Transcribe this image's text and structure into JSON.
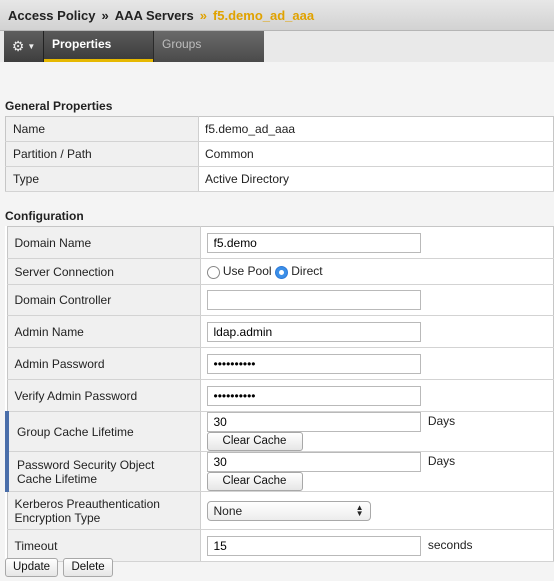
{
  "breadcrumb": {
    "items": [
      "Access Policy",
      "AAA Servers"
    ],
    "separator": "»",
    "current": "f5.demo_ad_aaa"
  },
  "tabs": {
    "gear_icon": "gear-icon",
    "properties": "Properties",
    "groups": "Groups"
  },
  "general": {
    "title": "General Properties",
    "rows": [
      {
        "label": "Name",
        "value": "f5.demo_ad_aaa"
      },
      {
        "label": "Partition / Path",
        "value": "Common"
      },
      {
        "label": "Type",
        "value": "Active Directory"
      }
    ]
  },
  "config": {
    "title": "Configuration",
    "domain_name": {
      "label": "Domain Name",
      "value": "f5.demo"
    },
    "server_connection": {
      "label": "Server Connection",
      "option_pool": "Use Pool",
      "option_direct": "Direct",
      "selected": "Direct"
    },
    "domain_controller": {
      "label": "Domain Controller",
      "value": ""
    },
    "admin_name": {
      "label": "Admin Name",
      "value": "ldap.admin"
    },
    "admin_password": {
      "label": "Admin Password",
      "value": "••••••••••"
    },
    "verify_password": {
      "label": "Verify Admin Password",
      "value": "••••••••••"
    },
    "group_cache": {
      "label": "Group Cache Lifetime",
      "value": "30",
      "unit": "Days",
      "button": "Clear Cache"
    },
    "pso_cache": {
      "label_line1": "Password Security Object",
      "label_line2": "Cache Lifetime",
      "value": "30",
      "unit": "Days",
      "button": "Clear Cache"
    },
    "kerberos": {
      "label_line1": "Kerberos Preauthentication",
      "label_line2": "Encryption Type",
      "value": "None"
    },
    "timeout": {
      "label": "Timeout",
      "value": "15",
      "unit": "seconds"
    }
  },
  "actions": {
    "update": "Update",
    "delete": "Delete"
  },
  "colors": {
    "accent": "#e6b800",
    "marker": "#4a6ea9",
    "radio_selected": "#3b8fe8"
  }
}
